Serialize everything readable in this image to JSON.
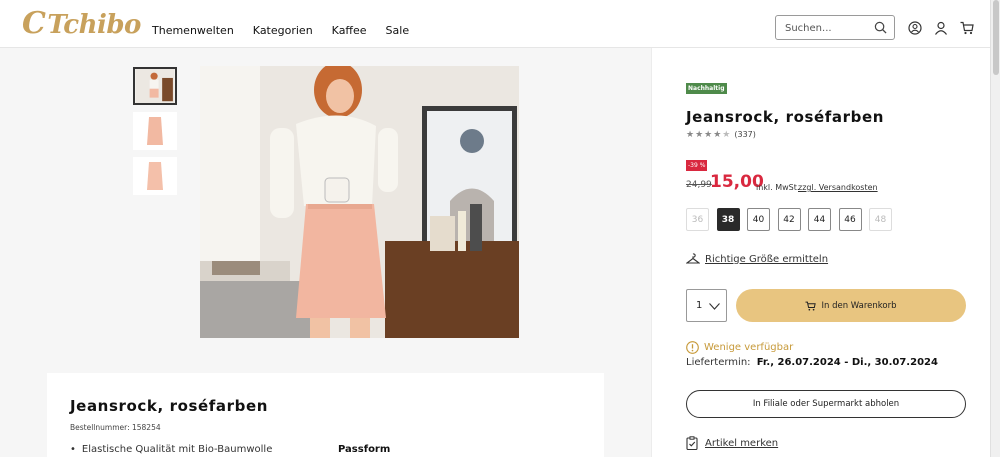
{
  "header": {
    "logo": "Tchibo",
    "nav": [
      "Themenwelten",
      "Kategorien",
      "Kaffee",
      "Sale"
    ],
    "search_placeholder": "Suchen..."
  },
  "product": {
    "badge": "Nachhaltig",
    "title": "Jeansrock, roséfarben",
    "rating_stars": 4.5,
    "rating_count": "(337)",
    "discount": "-39 %",
    "old_price": "24,99",
    "price": "15,00",
    "vat": "inkl. MwSt.",
    "shipping": "zzgl. Versandkosten",
    "sizes": [
      {
        "label": "36",
        "state": "disabled"
      },
      {
        "label": "38",
        "state": "selected"
      },
      {
        "label": "40",
        "state": "available"
      },
      {
        "label": "42",
        "state": "available"
      },
      {
        "label": "44",
        "state": "available"
      },
      {
        "label": "46",
        "state": "available"
      },
      {
        "label": "48",
        "state": "disabled"
      }
    ],
    "size_finder": "Richtige Größe ermitteln",
    "quantity": "1",
    "add_to_cart": "In den Warenkorb",
    "availability": "Wenige verfügbar",
    "delivery_label": "Liefertermin:",
    "delivery_dates": "Fr., 26.07.2024 - Di., 30.07.2024",
    "store_pickup": "In Filiale oder Supermarkt abholen",
    "wishlist": "Artikel merken"
  },
  "description": {
    "title": "Jeansrock, roséfarben",
    "article_number": "Bestellnummer: 158254",
    "bullet": "Elastische Qualität mit Bio-Baumwolle",
    "section_fit": "Passform"
  },
  "colors": {
    "brand_gold": "#c8a15c",
    "cart_button": "#e8c580",
    "sale_red": "#d9283f",
    "sustainable_green": "#4e8a4a",
    "availability_amber": "#c79a3a"
  }
}
